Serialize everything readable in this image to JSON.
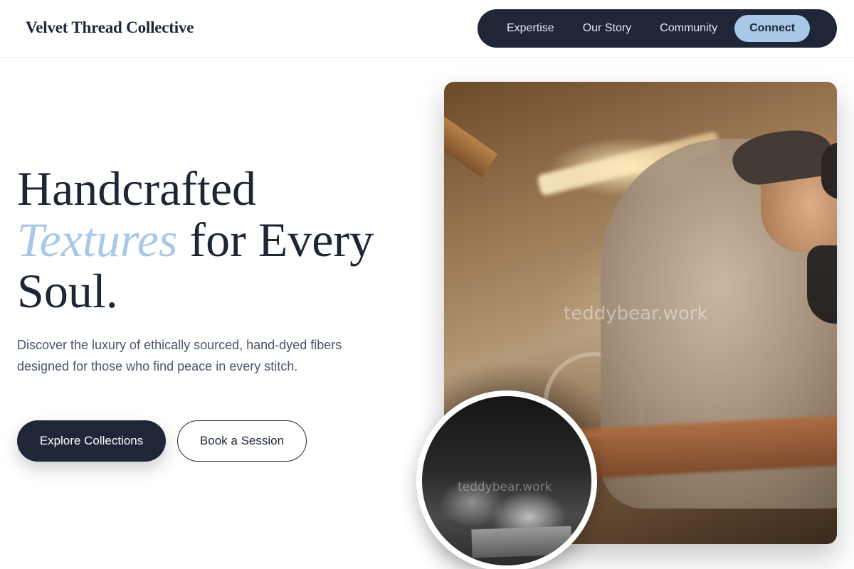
{
  "header": {
    "brand": "Velvet Thread Collective",
    "nav": {
      "links": [
        "Expertise",
        "Our Story",
        "Community"
      ],
      "cta": "Connect"
    }
  },
  "hero": {
    "headline": {
      "line1": "Handcrafted",
      "accent": "Textures",
      "line2_rest": " for Every",
      "line3": "Soul."
    },
    "lede": "Discover the luxury of ethically sourced, hand-dyed fibers designed for those who find peace in every stitch.",
    "primary_button": "Explore Collections",
    "secondary_button": "Book a Session"
  },
  "images": {
    "main_watermark": "teddybear.work",
    "inset_watermark": "teddybear.work"
  },
  "colors": {
    "navy": "#1e2638",
    "accent_blue": "#a9c7e6",
    "body_text": "#4a5568"
  }
}
